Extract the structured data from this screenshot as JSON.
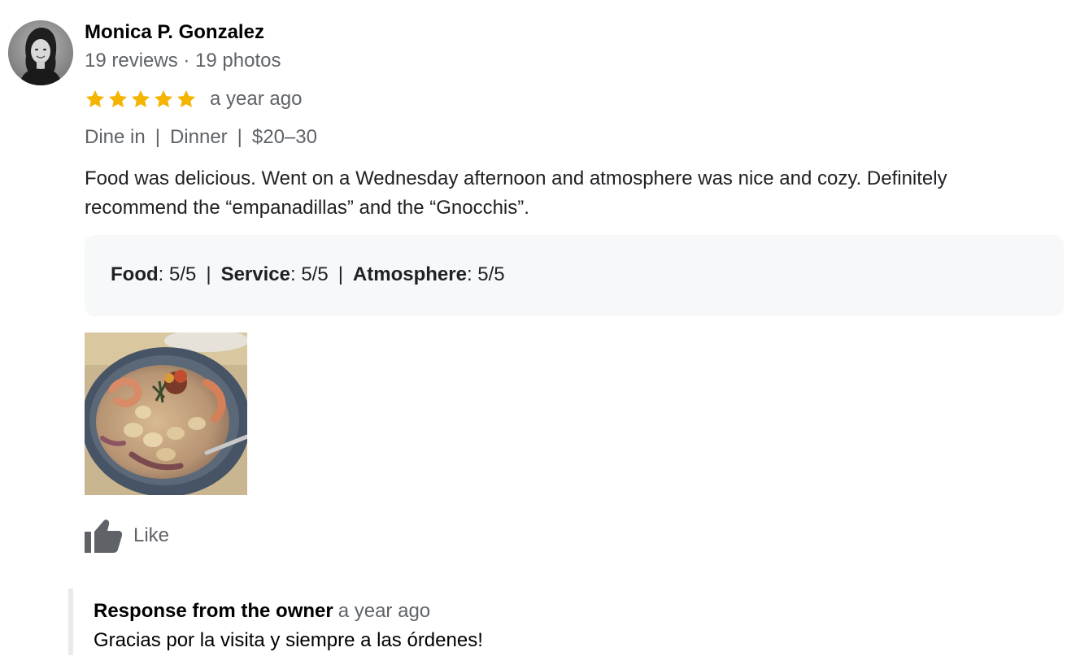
{
  "review": {
    "author": {
      "name": "Monica P. Gonzalez",
      "meta": "19 reviews · 19 photos",
      "avatar_icon": "profile-photo"
    },
    "rating": {
      "stars": 5,
      "max": 5,
      "star_color": "#f4b400",
      "date": "a year ago"
    },
    "tags": {
      "items": [
        "Dine in",
        "Dinner",
        "$20–30"
      ],
      "separator": "|"
    },
    "text": "Food was delicious. Went on a Wednesday afternoon and atmosphere was nice and cozy. Definitely recommend the “empanadillas” and the “Gnocchis”.",
    "sub_ratings": {
      "items": [
        {
          "label": "Food",
          "value": ": 5/5"
        },
        {
          "label": "Service",
          "value": ": 5/5"
        },
        {
          "label": "Atmosphere",
          "value": ": 5/5"
        }
      ],
      "separator": "|"
    },
    "photo": {
      "icon": "food-photo"
    },
    "like": {
      "label": "Like",
      "icon": "thumbs-up-icon"
    },
    "owner_response": {
      "title": "Response from the owner",
      "date": "a year ago",
      "text": "Gracias por la visita y siempre a las órdenes!"
    }
  }
}
